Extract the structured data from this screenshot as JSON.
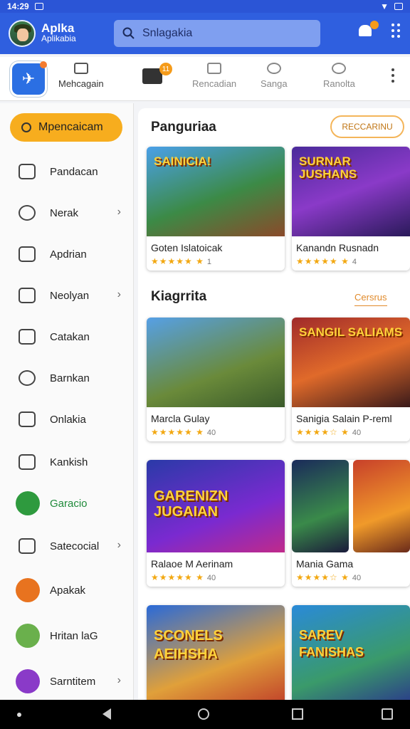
{
  "status_bar": {
    "time": "14:29"
  },
  "header": {
    "brand_line1": "Aplka",
    "brand_line2": "Aplikabia",
    "search_placeholder": "Snlagakia"
  },
  "tabs": [
    {
      "label": "Mehcagain"
    },
    {
      "label": "Rencadian"
    },
    {
      "label": "Sanga"
    },
    {
      "label": "Ranolta"
    }
  ],
  "tab_badge": "11",
  "sidebar": {
    "primary_label": "Mpencaicam",
    "items": [
      {
        "label": "Pandacan",
        "icon": "home-icon",
        "chevron": false
      },
      {
        "label": "Nerak",
        "icon": "user-icon",
        "chevron": true
      },
      {
        "label": "Apdrian",
        "icon": "bag-icon",
        "chevron": false
      },
      {
        "label": "Neolyan",
        "icon": "grid-icon",
        "chevron": true
      },
      {
        "label": "Catakan",
        "icon": "tag-icon",
        "chevron": false
      },
      {
        "label": "Barnkan",
        "icon": "person-icon",
        "chevron": false
      },
      {
        "label": "Onlakia",
        "icon": "tools-icon",
        "chevron": false
      },
      {
        "label": "Kankish",
        "icon": "calendar-icon",
        "chevron": false
      },
      {
        "label": "Garacio",
        "icon": "green-badge-icon",
        "chevron": false
      },
      {
        "label": "Satecocial",
        "icon": "search-tag-icon",
        "chevron": true
      },
      {
        "label": "Apakak",
        "icon": "app-avatar",
        "chevron": false
      },
      {
        "label": "Hritan laG",
        "icon": "game-avatar",
        "chevron": false
      },
      {
        "label": "Sarntitem",
        "icon": "purple-avatar",
        "chevron": true
      }
    ]
  },
  "sections": [
    {
      "title": "Panguriaa",
      "action": "RECCARINU"
    },
    {
      "title": "Kiagrrita",
      "action": "Cersrus"
    }
  ],
  "cards": [
    {
      "name": "Goten Islatoicak",
      "art": "SAINICIA!",
      "rating": 4.5,
      "count": "1"
    },
    {
      "name": "Kanandn Rusnadn",
      "art": "SURNAR JUSHANS",
      "rating": 4.5,
      "count": "4"
    },
    {
      "name": "Marcla Gulay",
      "art": "",
      "rating": 4.5,
      "count": "40"
    },
    {
      "name": "Sanigia Salain P-reml",
      "art": "SANGIL SALIAMS",
      "rating": 3.5,
      "count": "40"
    },
    {
      "name": "Ralaoe M Aerinam",
      "art": "GARENIZN JUGAIAN",
      "rating": 4.5,
      "count": "40"
    },
    {
      "name": "Mania Gama",
      "art": "",
      "rating": 3.5,
      "count": "40"
    },
    {
      "name": "",
      "art": "SCONELS AEIHSHA",
      "rating": 0,
      "count": ""
    },
    {
      "name": "",
      "art": "SAREV FANISHAS",
      "rating": 0,
      "count": ""
    }
  ],
  "colors": {
    "header_blue": "#2f5fdf",
    "accent_orange": "#f7ad1e",
    "star_gold": "#f2a812"
  }
}
